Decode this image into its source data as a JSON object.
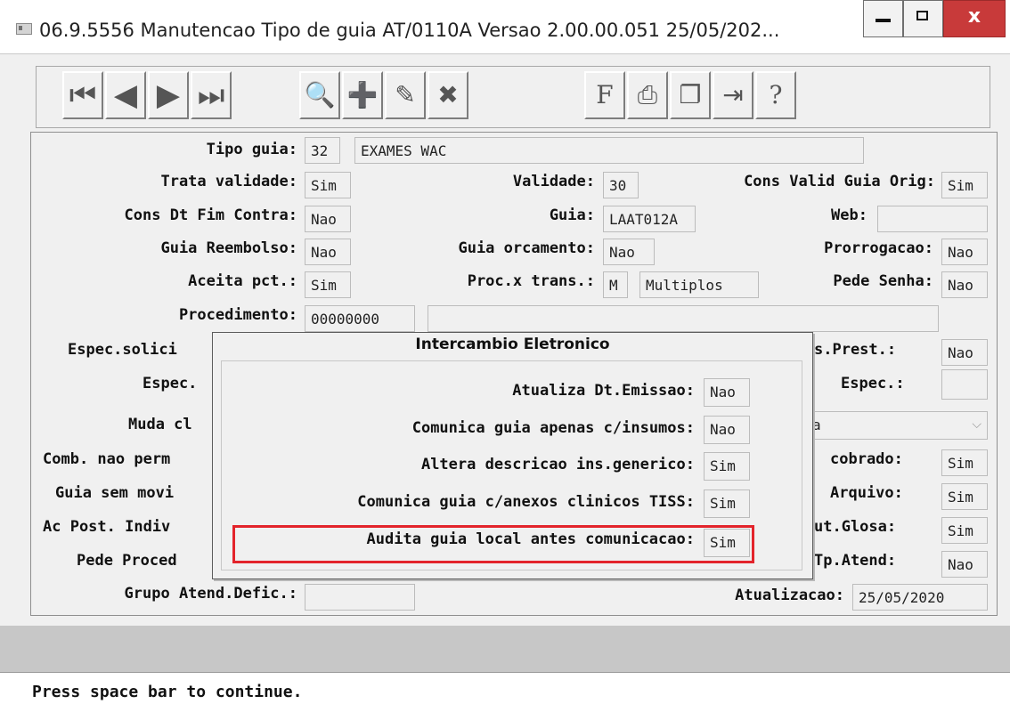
{
  "window": {
    "title": "06.9.5556 Manutencao  Tipo de guia AT/0110A Versao 2.00.00.051 25/05/202...",
    "close_label": "x"
  },
  "toolbar": {
    "buttons": [
      {
        "name": "first-record",
        "icon": "first-record-icon",
        "glyph": "⏮"
      },
      {
        "name": "previous-record",
        "icon": "previous-icon",
        "glyph": "◀"
      },
      {
        "name": "next-record",
        "icon": "next-icon",
        "glyph": "▶"
      },
      {
        "name": "last-record",
        "icon": "last-record-icon",
        "glyph": "⏭"
      },
      {
        "name": "search",
        "icon": "search-key-icon",
        "glyph": "🔍"
      },
      {
        "name": "add",
        "icon": "add-icon",
        "glyph": "➕"
      },
      {
        "name": "edit",
        "icon": "edit-icon",
        "glyph": "✎"
      },
      {
        "name": "delete",
        "icon": "delete-icon",
        "glyph": "✖"
      },
      {
        "name": "filter",
        "icon": "filter-icon",
        "glyph": "F"
      },
      {
        "name": "print",
        "icon": "print-icon",
        "glyph": "⎙"
      },
      {
        "name": "copy",
        "icon": "copy-icon",
        "glyph": "❐"
      },
      {
        "name": "exit",
        "icon": "exit-door-icon",
        "glyph": "⇥"
      },
      {
        "name": "help",
        "icon": "help-icon",
        "glyph": "?"
      }
    ]
  },
  "form": {
    "tipo_guia_label": "Tipo guia:",
    "tipo_guia_code": "32",
    "tipo_guia_desc": "EXAMES WAC",
    "trata_validade_label": "Trata validade:",
    "trata_validade": "Sim",
    "validade_label": "Validade:",
    "validade": "30",
    "cons_valid_label": "Cons Valid Guia Orig:",
    "cons_valid": "Sim",
    "cons_dt_fim_label": "Cons Dt Fim Contra:",
    "cons_dt_fim": "Nao",
    "guia_label": "Guia:",
    "guia": "LAAT012A",
    "web_label": "Web:",
    "web": "",
    "guia_reembolso_label": "Guia Reembolso:",
    "guia_reembolso": "Nao",
    "guia_orcamento_label": "Guia orcamento:",
    "guia_orcamento": "Nao",
    "prorrogacao_label": "Prorrogacao:",
    "prorrogacao": "Nao",
    "aceita_pct_label": "Aceita pct.:",
    "aceita_pct": "Sim",
    "proc_trans_label": "Proc.x trans.:",
    "proc_trans_code": "M",
    "proc_trans_desc": "Multiplos",
    "pede_senha_label": "Pede Senha:",
    "pede_senha": "Nao",
    "procedimento_label": "Procedimento:",
    "procedimento": "00000000",
    "procedimento_desc": "",
    "espec_solic_label": "Espec.solici",
    "espec_label": "Espec.",
    "muda_label": "Muda cl",
    "comb_label": "Comb. nao perm",
    "guia_sem_label": "Guia sem movi",
    "ac_post_label": "Ac Post. Indiv",
    "pede_proced_label": "Pede Proced",
    "grupo_label": "Grupo Atend.Defic.:",
    "grupo": "",
    "s_prest_label": "s.Prest.:",
    "s_prest": "Nao",
    "espec_r_label": "Espec.:",
    "espec_r": "",
    "muda_r_value": "a",
    "cobrado_label": "cobrado:",
    "cobrado": "Sim",
    "arquivo_label": "Arquivo:",
    "arquivo": "Sim",
    "ut_glosa_label": "ut.Glosa:",
    "ut_glosa": "Sim",
    "tp_atend_label": "Tp.Atend:",
    "tp_atend": "Nao",
    "atualizacao_label": "Atualizacao:",
    "atualizacao": "25/05/2020"
  },
  "popup": {
    "title": "Intercambio Eletronico",
    "rows": [
      {
        "label": "Atualiza Dt.Emissao:",
        "value": "Nao"
      },
      {
        "label": "Comunica guia apenas c/insumos:",
        "value": "Nao"
      },
      {
        "label": "Altera descricao ins.generico:",
        "value": "Sim"
      },
      {
        "label": "Comunica guia c/anexos clinicos TISS:",
        "value": "Sim"
      },
      {
        "label": "Audita guia local antes comunicacao:",
        "value": "Sim"
      }
    ]
  },
  "status": {
    "message": "Press space bar to continue."
  }
}
